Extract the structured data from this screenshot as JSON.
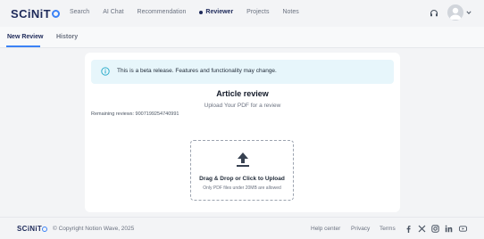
{
  "brand": {
    "logo_text_pre": "SCiNiT",
    "footer_logo_text_pre": "SCiNiT"
  },
  "nav": {
    "items": [
      {
        "label": "Search"
      },
      {
        "label": "AI Chat"
      },
      {
        "label": "Recommendation"
      },
      {
        "label": "Reviewer",
        "active": true
      },
      {
        "label": "Projects"
      },
      {
        "label": "Notes"
      }
    ]
  },
  "tabs": [
    {
      "label": "New Review",
      "active": true
    },
    {
      "label": "History"
    }
  ],
  "main": {
    "banner": "This is a beta release. Features and functionality may change.",
    "title": "Article review",
    "subtitle": "Upload Your PDF for a review",
    "remaining": "Remaining reviews: 9007199254740991",
    "dropzone": {
      "title": "Drag & Drop or Click to Upload",
      "subtitle": "Only PDF files under 20MB are allowed"
    }
  },
  "footer": {
    "copyright": "© Copyright Notion Wave, 2025",
    "links": [
      "Help center",
      "Privacy",
      "Terms"
    ],
    "social": [
      "facebook-icon",
      "x-icon",
      "instagram-icon",
      "linkedin-icon",
      "youtube-icon"
    ]
  },
  "colors": {
    "brand_navy": "#1e2a5a",
    "accent_blue": "#3b82f6",
    "banner_bg": "#e7f6fb",
    "info_cyan": "#22a8c8"
  }
}
